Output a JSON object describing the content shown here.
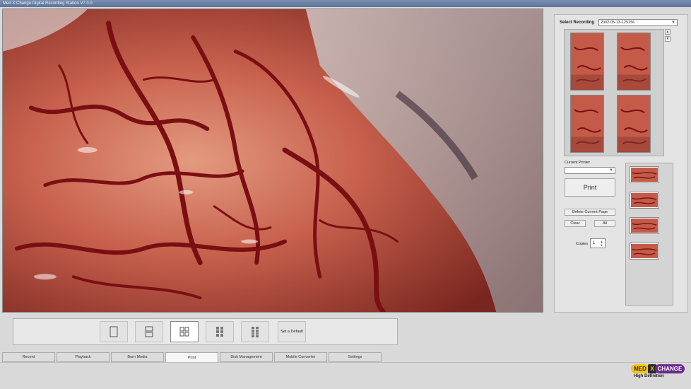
{
  "window": {
    "title": "Med X Change Digital Recording Station V7.0.0"
  },
  "right_panel": {
    "select_recording_label": "Select Recording",
    "recording_value": "2002-05-13-125256",
    "current_printer_label": "Current Printer",
    "current_printer_value": "",
    "print_label": "Print",
    "delete_page_label": "Delete Current Page",
    "clear_label": "Clear",
    "all_label": "All",
    "copies_label": "Copies",
    "copies_value": "1",
    "thumbnail_count": 4,
    "page_count": 4
  },
  "layout_bar": {
    "layouts": [
      "single-layout",
      "two-up-layout",
      "four-up-layout",
      "six-up-layout",
      "eight-up-layout"
    ],
    "active_index": 2,
    "set_default_label": "Set a Default"
  },
  "tabs": [
    "Record",
    "Playback",
    "Burn Media",
    "Print",
    "Disk Management",
    "Mobile Converter",
    "Settings"
  ],
  "active_tab": "Print",
  "logo": {
    "part1": "MED",
    "part2": "X",
    "part3": "CHANGE",
    "subtitle": "High Definition",
    "color_yellow": "#f5c518",
    "color_purple": "#6a2a8c"
  },
  "colors": {
    "tissue": "#b8433a",
    "vessel": "#7a0f12",
    "accent_blue": "#2d6fb8"
  }
}
